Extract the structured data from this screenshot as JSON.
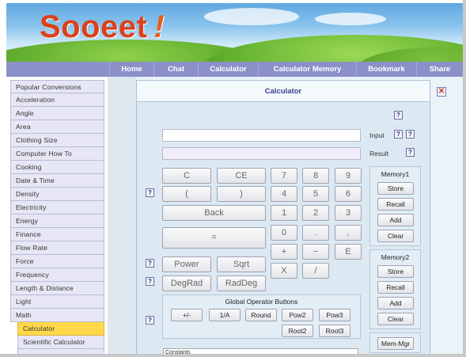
{
  "logo": {
    "text": "Sooeet",
    "bang": "!"
  },
  "nav": [
    "Home",
    "Chat",
    "Calculator",
    "Calculator Memory",
    "Bookmark",
    "Share"
  ],
  "sidebar": [
    "Popular Conversions",
    "Acceleration",
    "Angle",
    "Area",
    "Clothing Size",
    "Computer How To",
    "Cooking",
    "Date & Time",
    "Density",
    "Electricity",
    "Energy",
    "Finance",
    "Flow Rate",
    "Force",
    "Frequency",
    "Length & Distance",
    "Light",
    "Math"
  ],
  "sidebar_sub": [
    "Calculator",
    "Scientific Calculator",
    "..."
  ],
  "calc": {
    "title": "Calculator",
    "help": "?",
    "input_label": "Input",
    "result_label": "Result",
    "keys": {
      "c": "C",
      "ce": "CE",
      "open": "(",
      "close": ")",
      "back": "Back",
      "equals": "=",
      "power": "Power",
      "sqrt": "Sqrt",
      "degrad": "DegRad",
      "raddeg": "RadDeg",
      "d7": "7",
      "d8": "8",
      "d9": "9",
      "d4": "4",
      "d5": "5",
      "d6": "6",
      "d1": "1",
      "d2": "2",
      "d3": "3",
      "d0": "0",
      "dot": ".",
      "comma": ",",
      "plus": "+",
      "minus": "−",
      "exp": "E",
      "times": "X",
      "div": "/"
    },
    "global_ops": {
      "title": "Global Operator Buttons",
      "buttons": [
        "+/-",
        "1/A",
        "Round",
        "Pow2",
        "Pow3",
        "Root2",
        "Root3"
      ]
    },
    "memory1": {
      "title": "Memory1",
      "buttons": [
        "Store",
        "Recall",
        "Add",
        "Clear"
      ]
    },
    "memory2": {
      "title": "Memory2",
      "buttons": [
        "Store",
        "Recall",
        "Add",
        "Clear"
      ]
    },
    "mem_mgr": "Mem-Mgr",
    "select": "Constants"
  },
  "close": "✕",
  "colors": {
    "nav": "#8b90c9",
    "logo": "#d9421b",
    "active": "#ffd84a"
  }
}
